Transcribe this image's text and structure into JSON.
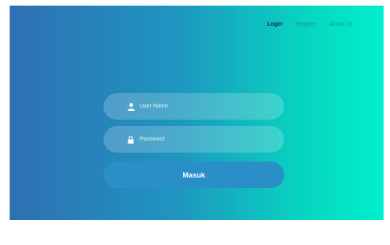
{
  "nav": {
    "items": [
      {
        "label": "Login"
      },
      {
        "label": "Register"
      },
      {
        "label": "About Us"
      }
    ]
  },
  "form": {
    "username_placeholder": "User Name",
    "password_placeholder": "Password",
    "submit_label": "Masuk"
  },
  "icons": {
    "username": "user-icon",
    "password": "lock-icon"
  },
  "colors": {
    "gradient_start": "#2f6fb3",
    "gradient_end": "#00efcc",
    "button": "#2a8fc7",
    "active_nav": "#1b2a3a"
  }
}
